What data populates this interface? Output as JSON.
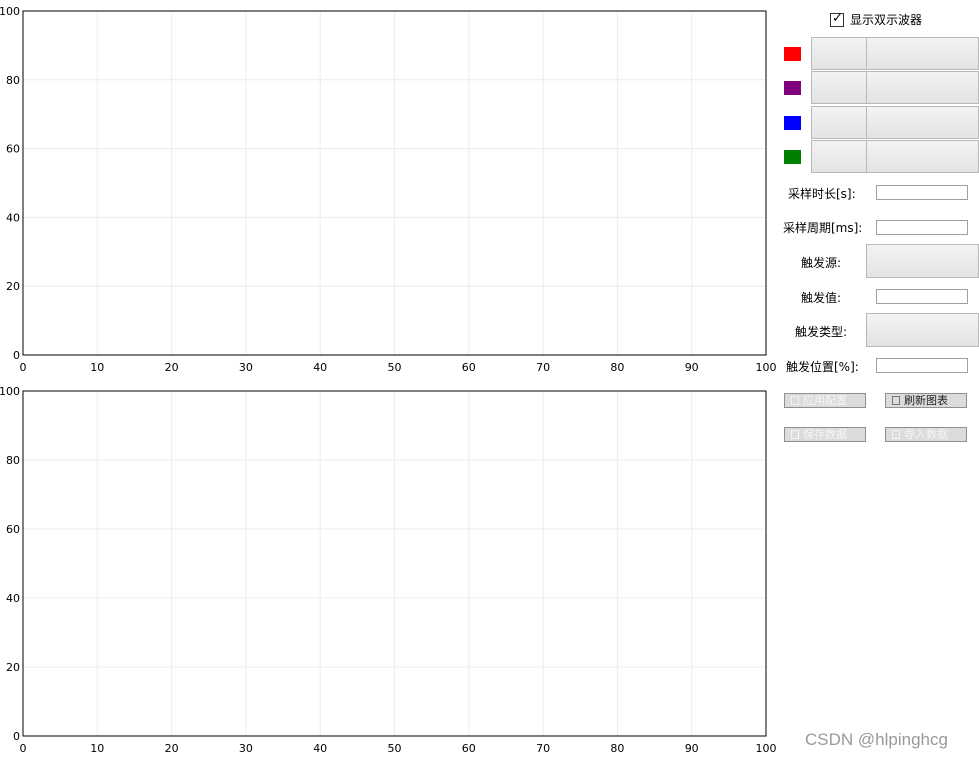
{
  "panel": {
    "dual_scope_label": "显示双示波器",
    "dual_scope_checked": true,
    "channel_colors": [
      "#ff0000",
      "#800080",
      "#0000ff",
      "#008000"
    ],
    "fields": {
      "sample_duration_label": "采样时长[s]:",
      "sample_period_label": "采样周期[ms]:",
      "trigger_source_label": "触发源:",
      "trigger_value_label": "触发值:",
      "trigger_type_label": "触发类型:",
      "trigger_position_label": "触发位置[%]:"
    },
    "buttons": {
      "apply_config": "应用配置",
      "refresh_chart": "刷新图表",
      "save_data": "保存数据",
      "import_data": "导入数据"
    }
  },
  "watermark": "CSDN @hlpinghcg",
  "chart_data": [
    {
      "type": "line",
      "series": [],
      "xlim": [
        0,
        100
      ],
      "ylim": [
        0,
        100
      ],
      "x_ticks": [
        0,
        10,
        20,
        30,
        40,
        50,
        60,
        70,
        80,
        90,
        100
      ],
      "y_ticks": [
        0,
        20,
        40,
        60,
        80,
        100
      ],
      "grid": true
    },
    {
      "type": "line",
      "series": [],
      "xlim": [
        0,
        100
      ],
      "ylim": [
        0,
        100
      ],
      "x_ticks": [
        0,
        10,
        20,
        30,
        40,
        50,
        60,
        70,
        80,
        90,
        100
      ],
      "y_ticks": [
        0,
        20,
        40,
        60,
        80,
        100
      ],
      "grid": true
    }
  ]
}
